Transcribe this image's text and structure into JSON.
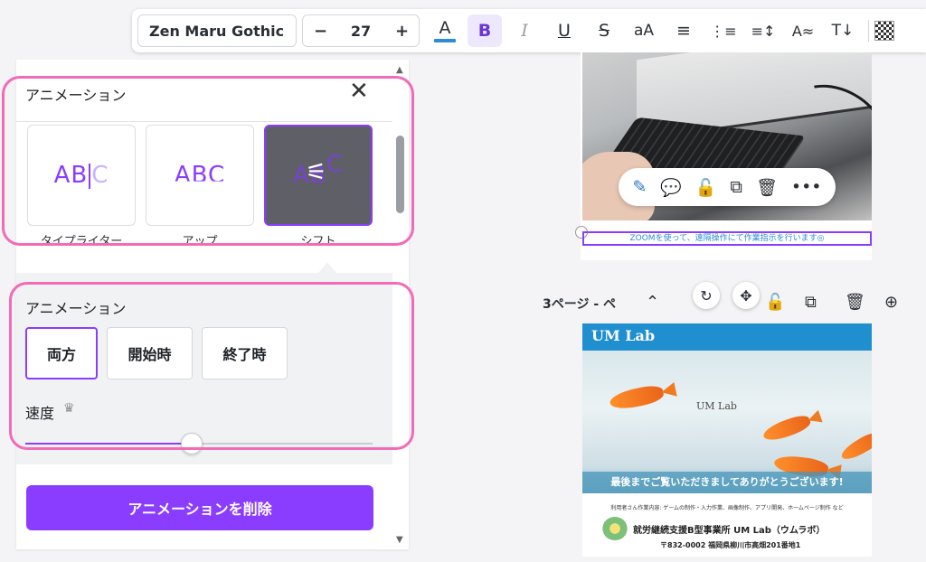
{
  "toolbar": {
    "font_name": "Zen Maru Gothic",
    "minus": "−",
    "font_size": "27",
    "plus": "+",
    "text_color": "A",
    "bold": "B",
    "italic": "I",
    "underline": "U",
    "strikethrough": "S",
    "case": "aA",
    "align": "≡",
    "list": "⋮≡",
    "spacing": "≡↕",
    "effects": "A≈",
    "text_direction": "T↓"
  },
  "panel": {
    "title": "アニメーション",
    "close": "✕",
    "cards": [
      {
        "preview": "AB",
        "preview_tail": "C",
        "label": "タイプライター"
      },
      {
        "preview": "ABC",
        "label": "アップ"
      },
      {
        "preview": "AB",
        "preview_tail": "C",
        "label": "シフト"
      }
    ],
    "sub_title": "アニメーション",
    "options": [
      "両方",
      "開始時",
      "終了時"
    ],
    "selected_option": "両方",
    "speed_label": "速度",
    "speed_value": 0.48,
    "delete_button": "アニメーションを削除"
  },
  "canvas": {
    "caption": "ZOOMを使って、遠隔操作にて作業指示を行います◎",
    "page3_label": "3ページ - ペ",
    "p3_header": "UM Lab",
    "p3_center": "UM Lab",
    "p3_thanks": "最後までご覧いただきましてありがとうございます!",
    "p3_services": "利用者さん作業内容: ゲームの制作・入力作業、画像制作、アプリ開発、ホームページ制作 など",
    "p3_org": "就労継続支援B型事業所 UM Lab（ウムラボ）",
    "p3_addr": "〒832-0002 福岡県柳川市高畑201番地1"
  },
  "colors": {
    "accent": "#8b3dff",
    "highlight": "#f26bb6",
    "text_color_bar": "#2d8cd7"
  }
}
